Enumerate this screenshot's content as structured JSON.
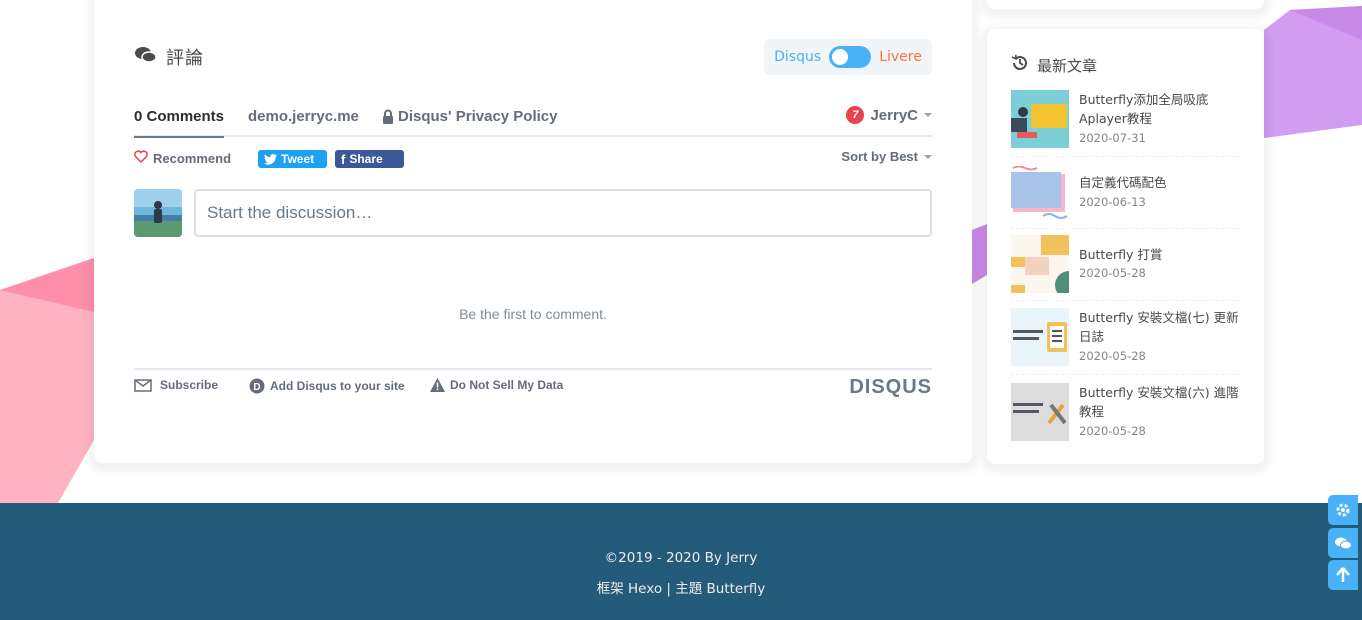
{
  "comments": {
    "title": "評論",
    "switch": {
      "left_label": "Disqus",
      "right_label": "Livere"
    },
    "disqus": {
      "tabs": [
        "0 Comments",
        "demo.jerryc.me",
        "Disqus' Privacy Policy"
      ],
      "user": {
        "name": "JerryC",
        "notifications": "7"
      },
      "recommend_label": "Recommend",
      "tweet_label": "Tweet",
      "share_label": "Share",
      "sort_label": "Sort by Best",
      "input_placeholder": "Start the discussion…",
      "empty_text": "Be the first to comment.",
      "footer": {
        "subscribe": "Subscribe",
        "add_disqus": "Add Disqus to your site",
        "do_not_sell": "Do Not Sell My Data",
        "logo": "DISQUS"
      }
    }
  },
  "aside": {
    "recent_title": "最新文章",
    "posts": [
      {
        "title": "Butterfly添加全局吸底Aplayer教程",
        "date": "2020-07-31"
      },
      {
        "title": "自定義代碼配色",
        "date": "2020-06-13"
      },
      {
        "title": "Butterfly 打賞",
        "date": "2020-05-28"
      },
      {
        "title": "Butterfly 安裝文檔(七) 更新日誌",
        "date": "2020-05-28"
      },
      {
        "title": "Butterfly 安裝文檔(六) 進階教程",
        "date": "2020-05-28"
      }
    ]
  },
  "footer": {
    "copyright": "©2019 - 2020 By Jerry",
    "framework": "框架 Hexo | 主題 Butterfly"
  },
  "colors": {
    "accent": "#49b1f5",
    "footer_bg": "#245a7a",
    "livere": "#ff7242",
    "badge": "#e8434c"
  }
}
